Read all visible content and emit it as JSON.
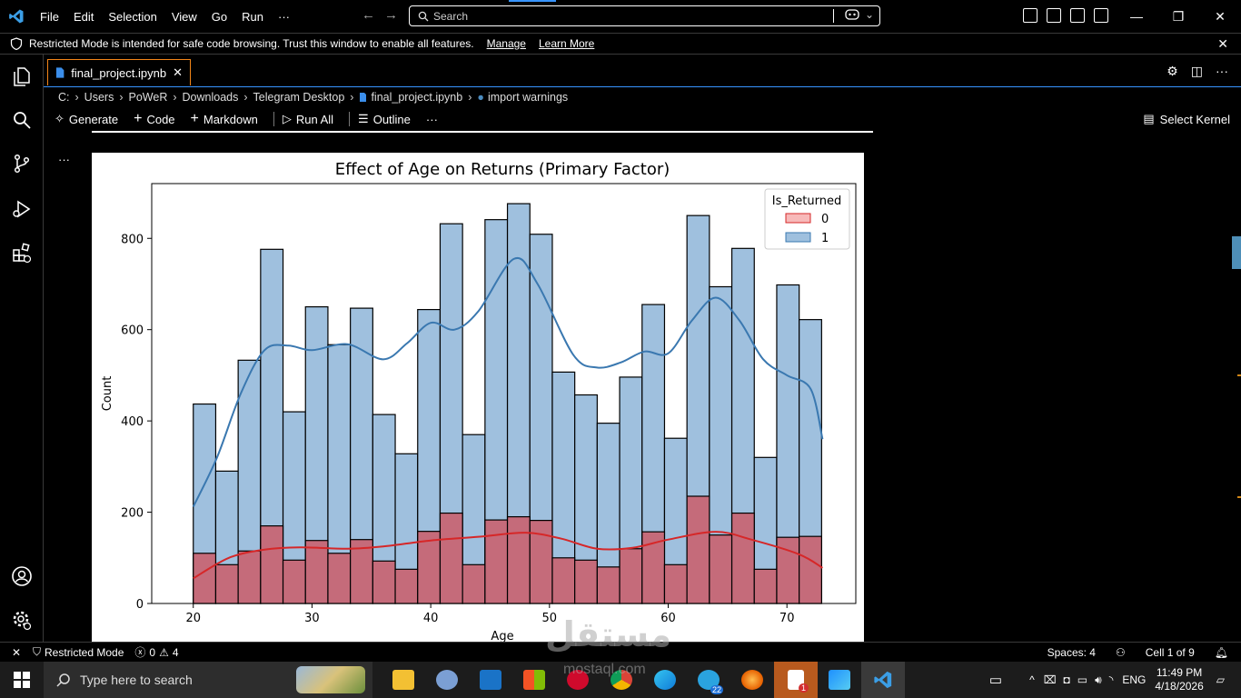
{
  "menu": [
    "File",
    "Edit",
    "Selection",
    "View",
    "Go",
    "Run",
    "···"
  ],
  "search": {
    "placeholder": "Search"
  },
  "banner": {
    "message": "Restricted Mode is intended for safe code browsing. Trust this window to enable all features.",
    "manage": "Manage",
    "learn_more": "Learn More"
  },
  "tab": {
    "label": "final_project.ipynb",
    "close": "✕"
  },
  "breadcrumb": [
    "C:",
    "Users",
    "PoWeR",
    "Downloads",
    "Telegram Desktop",
    "final_project.ipynb",
    "import warnings"
  ],
  "toolbar": {
    "generate": "Generate",
    "code": "Code",
    "markdown": "Markdown",
    "run_all": "Run All",
    "outline": "Outline",
    "more": "···",
    "select_kernel": "Select Kernel"
  },
  "cell": {
    "more": "···"
  },
  "chart_data": {
    "type": "bar",
    "title": "Effect of Age on Returns (Primary Factor)",
    "xlabel": "Age",
    "ylabel": "Count",
    "xlim": [
      16.5,
      75.8
    ],
    "ylim": [
      0,
      920
    ],
    "xticks": [
      20,
      30,
      40,
      50,
      60,
      70
    ],
    "yticks": [
      0,
      200,
      400,
      600,
      800
    ],
    "legend": {
      "title": "Is_Returned",
      "placement": "top-right",
      "entries": [
        "0",
        "1"
      ]
    },
    "colors": {
      "returned_0": "#f08080",
      "returned_1": "#9fc0de",
      "overlap": "#c56b7a",
      "kde_0": "#d62728",
      "kde_1": "#3a78b0"
    },
    "bin_start": 20,
    "bin_width": 1.89,
    "series": [
      {
        "name": "0",
        "values": [
          110,
          85,
          115,
          170,
          95,
          138,
          110,
          140,
          93,
          75,
          158,
          198,
          85,
          183,
          190,
          182,
          100,
          95,
          80,
          120,
          157,
          85,
          235,
          150,
          198,
          75,
          145,
          147
        ]
      },
      {
        "name": "1",
        "values": [
          437,
          290,
          533,
          776,
          420,
          650,
          567,
          647,
          414,
          328,
          644,
          832,
          370,
          841,
          876,
          809,
          507,
          457,
          395,
          496,
          655,
          362,
          850,
          694,
          778,
          320,
          698,
          622
        ]
      }
    ],
    "kde": {
      "0": [
        [
          20,
          55
        ],
        [
          23,
          100
        ],
        [
          26,
          118
        ],
        [
          29,
          123
        ],
        [
          33,
          120
        ],
        [
          36,
          125
        ],
        [
          40,
          138
        ],
        [
          44,
          146
        ],
        [
          48,
          155
        ],
        [
          51,
          142
        ],
        [
          54,
          120
        ],
        [
          57,
          122
        ],
        [
          60,
          140
        ],
        [
          64,
          157
        ],
        [
          67,
          140
        ],
        [
          71,
          108
        ],
        [
          73,
          78
        ]
      ],
      "1": [
        [
          20,
          212
        ],
        [
          22,
          320
        ],
        [
          24,
          460
        ],
        [
          26,
          555
        ],
        [
          28,
          565
        ],
        [
          30,
          555
        ],
        [
          33,
          568
        ],
        [
          36,
          535
        ],
        [
          38,
          570
        ],
        [
          40,
          615
        ],
        [
          42,
          600
        ],
        [
          44,
          640
        ],
        [
          47,
          755
        ],
        [
          49,
          700
        ],
        [
          52,
          545
        ],
        [
          54,
          517
        ],
        [
          56,
          528
        ],
        [
          58,
          552
        ],
        [
          60,
          548
        ],
        [
          62,
          620
        ],
        [
          64,
          670
        ],
        [
          66,
          620
        ],
        [
          68,
          535
        ],
        [
          70,
          500
        ],
        [
          72,
          470
        ],
        [
          73,
          360
        ]
      ]
    }
  },
  "statusbar": {
    "restricted": "Restricted Mode",
    "errors": "0",
    "warnings": "4",
    "spaces": "Spaces: 4",
    "cell": "Cell 1 of 9"
  },
  "taskbar": {
    "search_placeholder": "Type here to search",
    "telegram_badge": "22",
    "notes_badge": "1",
    "lang": "ENG",
    "time": "11:49 PM",
    "date": "4/18/2026"
  },
  "watermark": {
    "text": "مستقل",
    "sub": "mostaql.com"
  }
}
